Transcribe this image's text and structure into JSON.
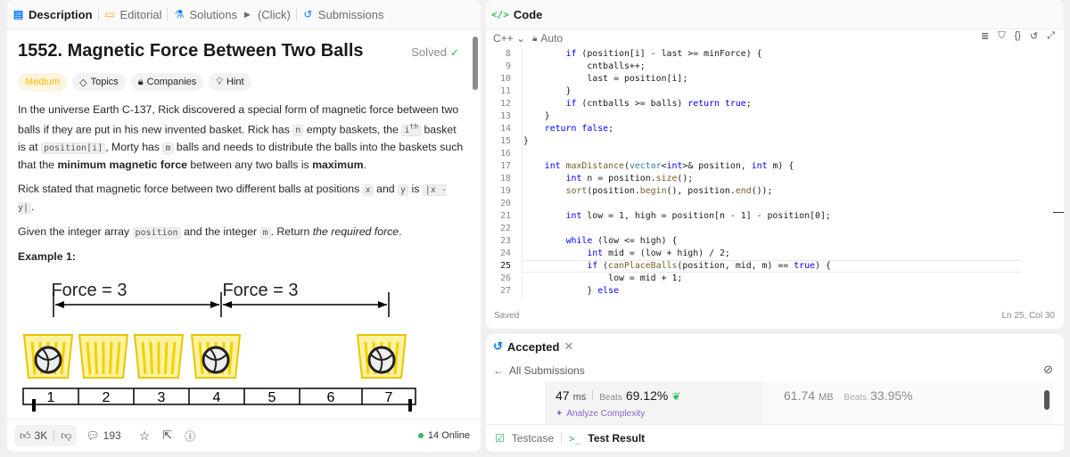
{
  "left": {
    "tabs": [
      {
        "label": "Description",
        "icon": "document-icon"
      },
      {
        "label": "Editorial",
        "icon": "book-icon"
      },
      {
        "label": "Solutions",
        "icon": "flask-icon"
      },
      {
        "label": "(Click)",
        "icon": "play-icon"
      },
      {
        "label": "Submissions",
        "icon": "history-icon"
      }
    ],
    "title": "1552. Magnetic Force Between Two Balls",
    "status": "Solved",
    "tags": {
      "difficulty": "Medium",
      "topics": "Topics",
      "companies": "Companies",
      "hint": "Hint"
    },
    "desc": {
      "p1_a": "In the universe Earth C-137, Rick discovered a special form of magnetic force between two balls if they are put in his new invented basket. Rick has ",
      "n": "n",
      "p1_b": " empty baskets, the ",
      "ith": "i",
      "th": "th",
      "p1_c": " basket is at ",
      "position_i": "position[i]",
      "p1_d": ", Morty has ",
      "m": "m",
      "p1_e": " balls and needs to distribute the balls into the baskets such that the ",
      "minimum_force": "minimum magnetic force",
      "p1_f": " between any two balls is ",
      "maximum": "maximum",
      "p1_g": ".",
      "p2_a": "Rick stated that magnetic force between two different balls at positions ",
      "x": "x",
      "p2_b": " and ",
      "y": "y",
      "p2_c": " is ",
      "abs": "|x - y|",
      "p2_d": ".",
      "p3_a": "Given the integer array ",
      "position": "position",
      "p3_b": " and the integer ",
      "m2": "m",
      "p3_c": ". Return ",
      "required": "the required force",
      "p3_d": "."
    },
    "example_label": "Example 1:",
    "figure": {
      "force_label_1": "Force = 3",
      "force_label_2": "Force = 3",
      "numbers": [
        "1",
        "2",
        "3",
        "4",
        "5",
        "6",
        "7"
      ]
    },
    "footer": {
      "likes": "3K",
      "comments": "193",
      "online": "14 Online"
    }
  },
  "editor": {
    "title": "Code",
    "language": "C++",
    "mode": "Auto",
    "lines": [
      {
        "n": "8",
        "code": "        if (position[i] - last >= minForce) {"
      },
      {
        "n": "9",
        "code": "            cntballs++;"
      },
      {
        "n": "10",
        "code": "            last = position[i];"
      },
      {
        "n": "11",
        "code": "        }"
      },
      {
        "n": "12",
        "code": "        if (cntballs >= balls) return true;"
      },
      {
        "n": "13",
        "code": "    }"
      },
      {
        "n": "14",
        "code": "    return false;"
      },
      {
        "n": "15",
        "code": "}"
      },
      {
        "n": "16",
        "code": ""
      },
      {
        "n": "17",
        "code": "    int maxDistance(vector<int>& position, int m) {"
      },
      {
        "n": "18",
        "code": "        int n = position.size();"
      },
      {
        "n": "19",
        "code": "        sort(position.begin(), position.end());"
      },
      {
        "n": "20",
        "code": ""
      },
      {
        "n": "21",
        "code": "        int low = 1, high = position[n - 1] - position[0];"
      },
      {
        "n": "22",
        "code": ""
      },
      {
        "n": "23",
        "code": "        while (low <= high) {"
      },
      {
        "n": "24",
        "code": "            int mid = (low + high) / 2;"
      },
      {
        "n": "25",
        "code": "            if (canPlaceBalls(position, mid, m) == true) {"
      },
      {
        "n": "26",
        "code": "                low = mid + 1;"
      },
      {
        "n": "27",
        "code": "            } else"
      }
    ],
    "status_left": "Saved",
    "status_right": "Ln 25, Col 30"
  },
  "result": {
    "title": "Accepted",
    "all_submissions": "All Submissions",
    "runtime": "47",
    "runtime_unit": "ms",
    "beats_label": "Beats",
    "runtime_beats": "69.12%",
    "analyze": "Analyze Complexity",
    "memory": "61.74",
    "memory_unit": "MB",
    "memory_beats": "33.95%",
    "bottom_tabs": [
      "Testcase",
      "Test Result"
    ]
  },
  "colors": {
    "accepted": "#2cbb5d",
    "medium": "#ffb800",
    "keyword": "#0000ff",
    "type": "#267f99"
  }
}
